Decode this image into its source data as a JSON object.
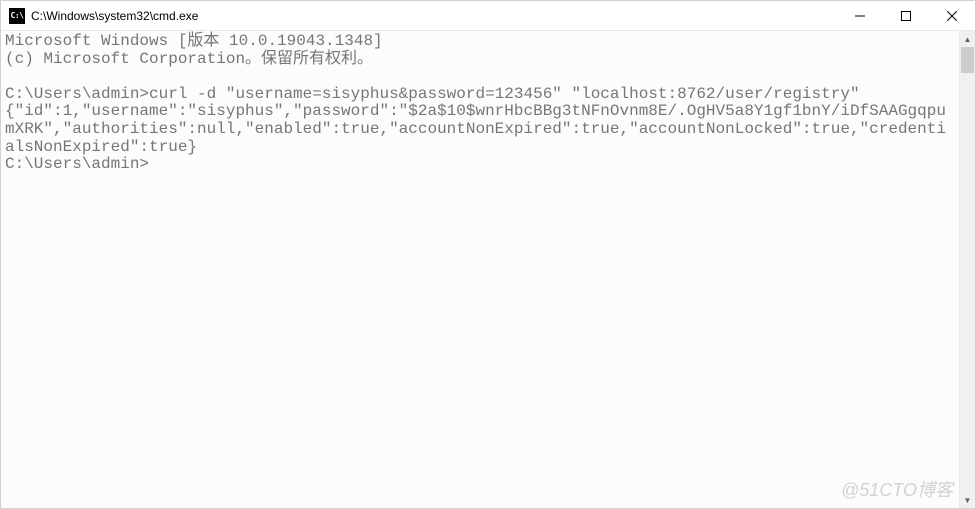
{
  "window": {
    "icon_label": "C:\\",
    "title": "C:\\Windows\\system32\\cmd.exe"
  },
  "console": {
    "lines": [
      "Microsoft Windows [版本 10.0.19043.1348]",
      "(c) Microsoft Corporation。保留所有权利。",
      "",
      "C:\\Users\\admin>curl -d \"username=sisyphus&password=123456\" \"localhost:8762/user/registry\"",
      "{\"id\":1,\"username\":\"sisyphus\",\"password\":\"$2a$10$wnrHbcBBg3tNFnOvnm8E/.OgHV5a8Y1gf1bnY/iDfSAAGgqpumXRK\",\"authorities\":null,\"enabled\":true,\"accountNonExpired\":true,\"accountNonLocked\":true,\"credentialsNonExpired\":true}",
      "C:\\Users\\admin>"
    ]
  },
  "watermark": "@51CTO博客"
}
